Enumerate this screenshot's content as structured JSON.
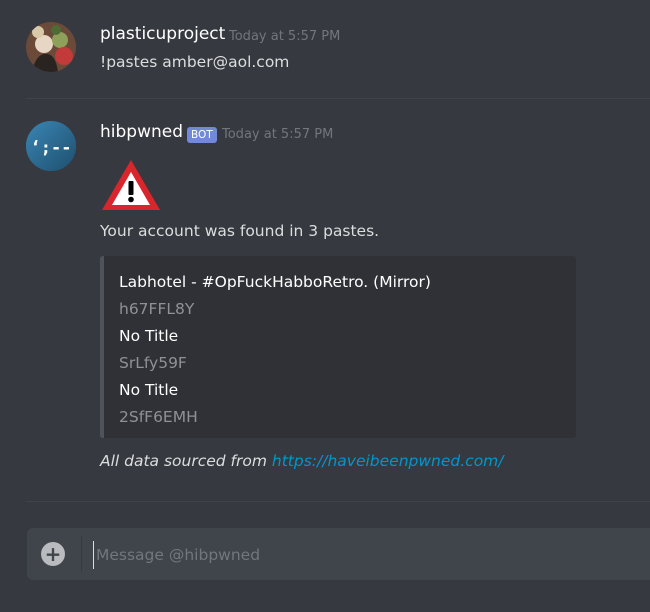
{
  "messages": [
    {
      "username": "plasticuproject",
      "timestamp": "Today at 5:57 PM",
      "text": "!pastes amber@aol.com"
    },
    {
      "username": "hibpwned",
      "badge": "BOT",
      "timestamp": "Today at 5:57 PM",
      "avatar_text": "‘;--",
      "text": "Your account was found in 3 pastes.",
      "embed": {
        "lines": [
          {
            "text": "Labhotel - #OpFuckHabboRetro.  (Mirror)",
            "kind": "title"
          },
          {
            "text": "h67FFL8Y",
            "kind": "val"
          },
          {
            "text": "No Title",
            "kind": "title"
          },
          {
            "text": "SrLfy59F",
            "kind": "val"
          },
          {
            "text": "No Title",
            "kind": "title"
          },
          {
            "text": "2SfF6EMH",
            "kind": "val"
          }
        ]
      },
      "footer_prefix": "All data sourced from ",
      "footer_link": "https://haveibeenpwned.com/"
    }
  ],
  "composer": {
    "placeholder": "Message @hibpwned"
  },
  "colors": {
    "background": "#36393f",
    "embed_bg": "#2f3136",
    "badge": "#7289da",
    "link": "#0096cf",
    "warning_red": "#d9262d"
  },
  "icons": [
    "user-avatar",
    "bot-avatar",
    "warning-icon",
    "plus-icon"
  ]
}
